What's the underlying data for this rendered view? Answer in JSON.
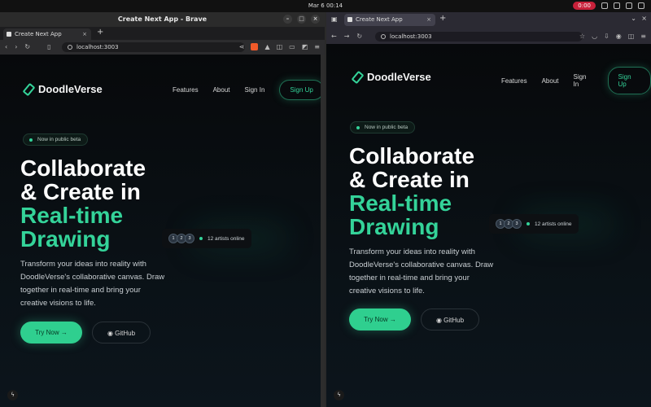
{
  "system": {
    "clock": "Mar 6  00:14",
    "recording": "0:00"
  },
  "left": {
    "window_title": "Create Next App - Brave",
    "tab_title": "Create Next App",
    "url": "localhost:3003"
  },
  "right": {
    "tab_title": "Create Next App",
    "url": "localhost:3003"
  },
  "site": {
    "brand": "DoodleVerse",
    "nav": {
      "features": "Features",
      "about": "About",
      "signin": "Sign In",
      "signup": "Sign Up"
    },
    "badge": "Now in public beta",
    "hero_line1": "Collaborate",
    "hero_line2": "& Create in",
    "hero_line3": "Real-time",
    "hero_line4": "Drawing",
    "description": "Transform your ideas into reality with DoodleVerse's collaborative canvas. Draw together in real-time and bring your creative visions to life.",
    "try_now": "Try Now",
    "github": "GitHub",
    "avatars": [
      "1",
      "2",
      "3"
    ],
    "online": "12 artists online"
  },
  "colors": {
    "accent": "#34d399",
    "background": "#07090b"
  }
}
